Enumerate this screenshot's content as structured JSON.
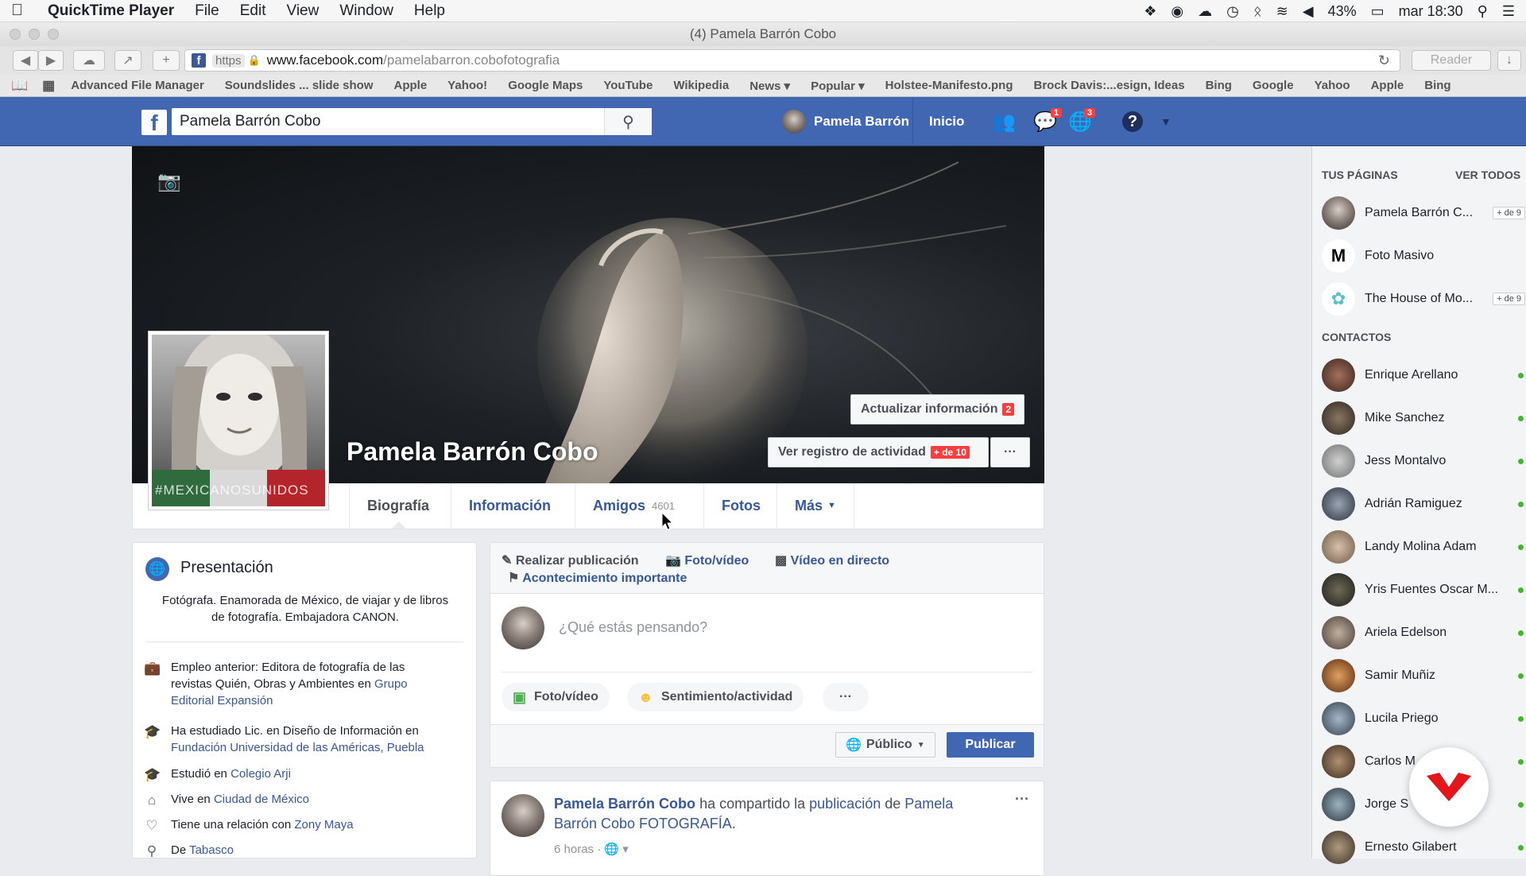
{
  "menubar": {
    "app_name": "QuickTime Player",
    "menus": [
      "File",
      "Edit",
      "View",
      "Window",
      "Help"
    ],
    "battery": "43%",
    "clock": "mar 18:30"
  },
  "window": {
    "title": "(4) Pamela Barrón Cobo"
  },
  "toolbar": {
    "url_scheme": "https",
    "url_domain": "www.facebook.com",
    "url_path": "/pamelabarron.cobofotografia",
    "reader_label": "Reader"
  },
  "bookmarks": [
    "Advanced File Manager",
    "Soundslides ... slide show",
    "Apple",
    "Yahoo!",
    "Google Maps",
    "YouTube",
    "Wikipedia",
    "News ▾",
    "Popular ▾",
    "Holstee-Manifesto.png",
    "Brock Davis:...esign, Ideas",
    "Bing",
    "Google",
    "Yahoo",
    "Apple",
    "Bing"
  ],
  "fb": {
    "search_value": "Pamela Barrón Cobo",
    "user_name": "Pamela Barrón",
    "home_label": "Inicio",
    "messages_badge": "1",
    "notifications_badge": "3"
  },
  "profile": {
    "name": "Pamela Barrón Cobo",
    "picture_overlay_text": "#MEXICANOSUNIDOS",
    "update_info_label": "Actualizar información",
    "update_info_badge": "2",
    "activity_log_label": "Ver registro de actividad",
    "activity_log_badge": "+ de 10",
    "more_dots": "···"
  },
  "tabs": {
    "biography": "Biografía",
    "info": "Información",
    "friends": "Amigos",
    "friends_count": "4601",
    "photos": "Fotos",
    "more": "Más"
  },
  "intro": {
    "title": "Presentación",
    "bio": "Fotógrafa. Enamorada de México, de viajar y de libros de fotografía. Embajadora CANON.",
    "work_prefix": "Empleo anterior: Editora de fotografía de las revistas Quién, Obras y Ambientes en ",
    "work_link": "Grupo Editorial Expansión",
    "study1_prefix": "Ha estudiado Lic. en Diseño de Información en ",
    "study1_link": "Fundación Universidad de las Américas, Puebla",
    "study2_prefix": "Estudió en ",
    "study2_link": "Colegio Arji",
    "lives_prefix": "Vive en ",
    "lives_link": "Ciudad de México",
    "relationship_prefix": "Tiene una relación con ",
    "relationship_link": "Zony Maya",
    "from_prefix": "De ",
    "from_link": "Tabasco"
  },
  "composer": {
    "create_post": "Realizar publicación",
    "photo_video": "Foto/vídeo",
    "live_video": "Vídeo en directo",
    "life_event": "Acontecimiento importante",
    "placeholder": "¿Qué estás pensando?",
    "pill_photo": "Foto/vídeo",
    "pill_feeling": "Sentimiento/actividad",
    "pill_more": "···",
    "audience": "Público",
    "publish": "Publicar"
  },
  "post": {
    "author": "Pamela Barrón Cobo",
    "shared_text": "ha compartido la",
    "publication_link": "publicación",
    "of_text": "de",
    "page_link": "Pamela Barrón Cobo FOTOGRAFÍA",
    "time": "6 horas ·",
    "menu_dots": "···"
  },
  "sidebar": {
    "pages_header": "TUS PÁGINAS",
    "see_all": "VER TODOS",
    "pages": [
      {
        "name": "Pamela Barrón C...",
        "badge": "+ de 9"
      },
      {
        "name": "Foto Masivo",
        "badge": ""
      },
      {
        "name": "The House of Mo...",
        "badge": "+ de 9"
      }
    ],
    "contacts_header": "CONTACTOS",
    "contacts": [
      "Enrique Arellano",
      "Mike Sanchez",
      "Jess Montalvo",
      "Adrián Ramiguez",
      "Landy Molina Adam",
      "Yris Fuentes Oscar M...",
      "Ariela Edelson",
      "Samir Muñiz",
      "Lucila Priego",
      "Carlos M",
      "Jorge S",
      "Ernesto Gilabert"
    ]
  },
  "colors": {
    "fb_blue": "#4267b2",
    "link_blue": "#365899",
    "badge_red": "#fa3e3e",
    "online_green": "#42b72a"
  }
}
